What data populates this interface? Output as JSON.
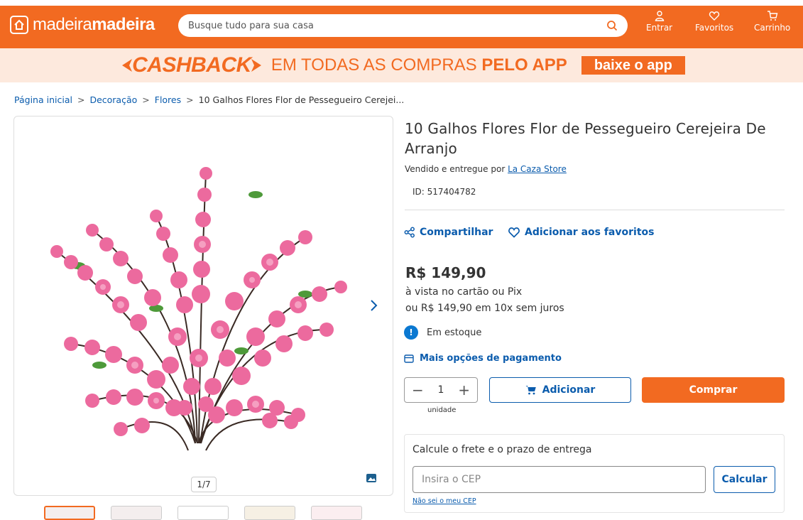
{
  "header": {
    "brand_light": "madeira",
    "brand_bold": "madeira",
    "search_placeholder": "Busque tudo para sua casa",
    "nav": {
      "login": "Entrar",
      "favorites": "Favoritos",
      "cart": "Carrinho"
    }
  },
  "banner": {
    "cashback": "CASHBACK",
    "text_regular": "EM TODAS AS COMPRAS",
    "text_bold": "PELO APP",
    "button": "baixe o app"
  },
  "breadcrumb": [
    "Página inicial",
    "Decoração",
    "Flores",
    "10 Galhos Flores Flor de Pessegueiro Cerejei..."
  ],
  "gallery": {
    "counter": "1/7"
  },
  "product": {
    "title": "10 Galhos Flores Flor de Pessegueiro Cerejeira De Arranjo",
    "sold_by_prefix": "Vendido e entregue por",
    "seller": "La Caza Store",
    "id": "ID: 517404782",
    "share": "Compartilhar",
    "favorite": "Adicionar aos favoritos",
    "price": "R$ 149,90",
    "payment_cash": "à vista no cartão ou Pix",
    "payment_installments": "ou R$ 149,90 em 10x sem juros",
    "stock": "Em estoque",
    "payment_options": "Mais opções de pagamento",
    "quantity": "1",
    "unit": "unidade",
    "add_button": "Adicionar",
    "buy_button": "Comprar"
  },
  "shipping": {
    "title": "Calcule o frete e o prazo de entrega",
    "cep_placeholder": "Insira o CEP",
    "calculate": "Calcular",
    "unknown_cep": "Não sei o meu CEP"
  },
  "colors": {
    "brand": "#f26a21",
    "link": "#0b5cad",
    "banner_bg": "#fde9dd",
    "info": "#0b78d1"
  }
}
